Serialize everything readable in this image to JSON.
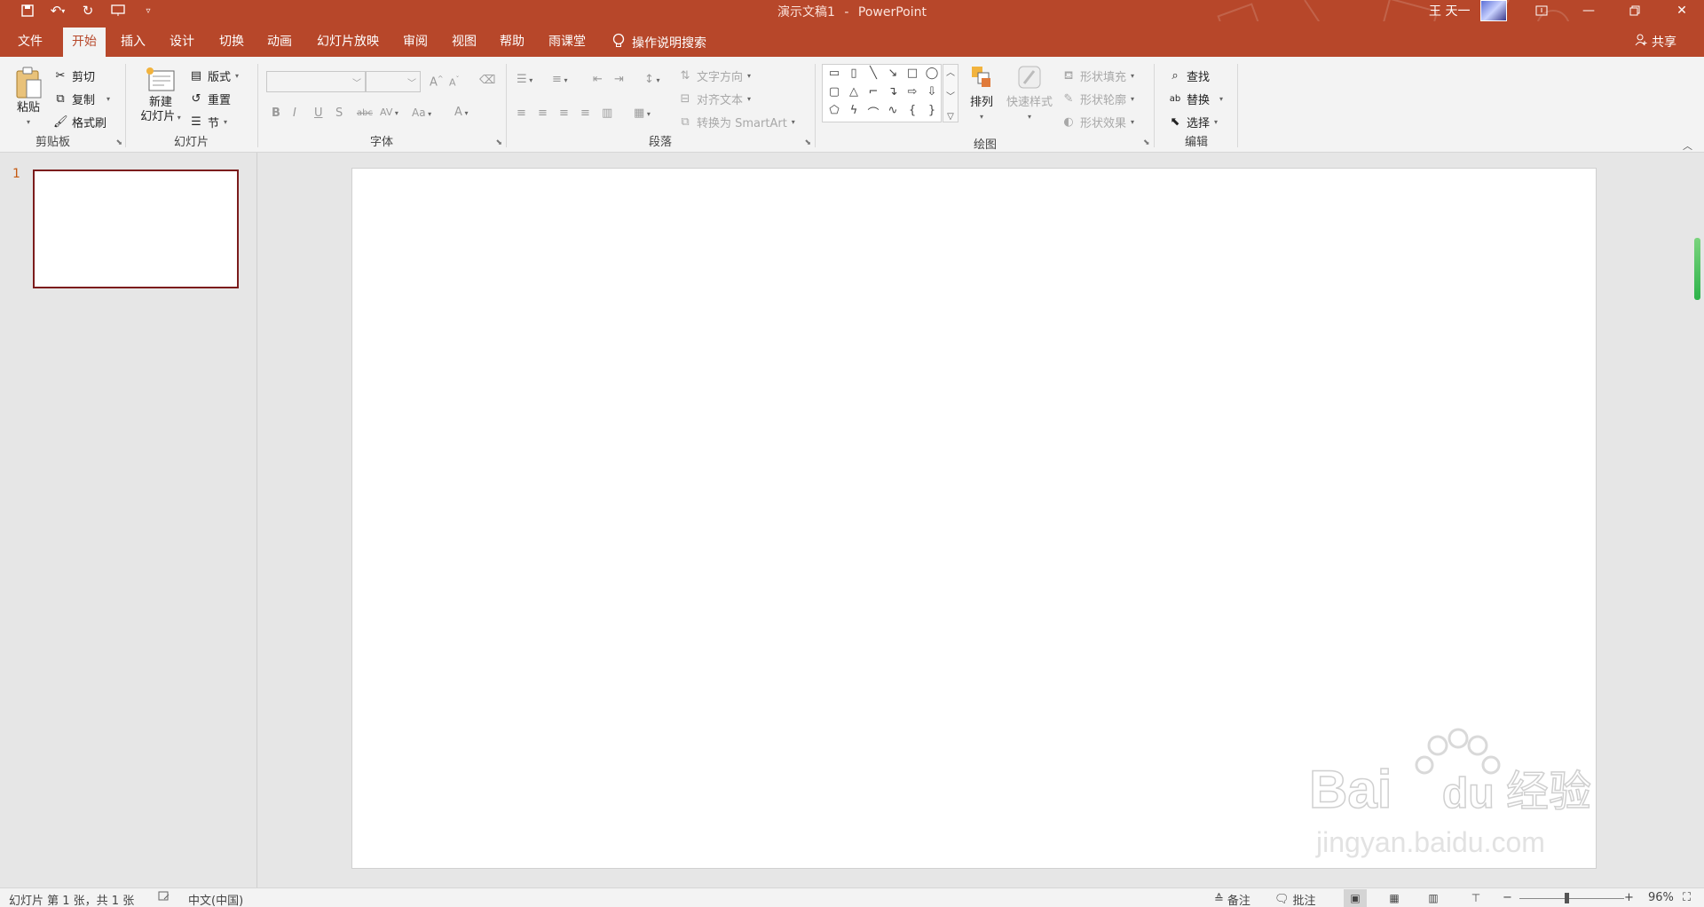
{
  "title": {
    "doc_name": "演示文稿1",
    "separator": "-",
    "app_name": "PowerPoint",
    "user_name": "王 天一"
  },
  "tabs": [
    "文件",
    "开始",
    "插入",
    "设计",
    "切换",
    "动画",
    "幻灯片放映",
    "审阅",
    "视图",
    "帮助",
    "雨课堂"
  ],
  "tell_me": "操作说明搜索",
  "share": "共享",
  "ribbon": {
    "clipboard": {
      "label": "剪贴板",
      "paste": "粘贴",
      "cut": "剪切",
      "copy": "复制",
      "format_painter": "格式刷"
    },
    "slides": {
      "label": "幻灯片",
      "new_slide_line1": "新建",
      "new_slide_line2": "幻灯片",
      "layout": "版式",
      "reset": "重置",
      "section": "节"
    },
    "font": {
      "label": "字体",
      "bold": "B",
      "italic": "I",
      "underline": "U",
      "shadow": "S",
      "strike": "abc",
      "spacing": "AV",
      "case": "Aa",
      "color": "A",
      "grow": "A",
      "shrink": "A"
    },
    "paragraph": {
      "label": "段落",
      "text_direction": "文字方向",
      "align_text": "对齐文本",
      "smartart": "转换为 SmartArt"
    },
    "drawing": {
      "label": "绘图",
      "arrange": "排列",
      "quick_styles": "快速样式",
      "shape_fill": "形状填充",
      "shape_outline": "形状轮廓",
      "shape_effects": "形状效果"
    },
    "editing": {
      "label": "编辑",
      "find": "查找",
      "replace": "替换",
      "select": "选择"
    }
  },
  "thumbnails": [
    {
      "number": "1"
    }
  ],
  "watermark": {
    "brand": "Bai",
    "brand2": "du",
    "cn": "经验",
    "url": "jingyan.baidu.com"
  },
  "status": {
    "slide_info": "幻灯片 第 1 张，共 1 张",
    "language": "中文(中国)",
    "notes": "备注",
    "comments": "批注",
    "zoom_minus": "−",
    "zoom_plus": "+",
    "zoom_level": "96%"
  },
  "colors": {
    "accent": "#b7472a",
    "thumb_border": "#7b1c1c"
  }
}
